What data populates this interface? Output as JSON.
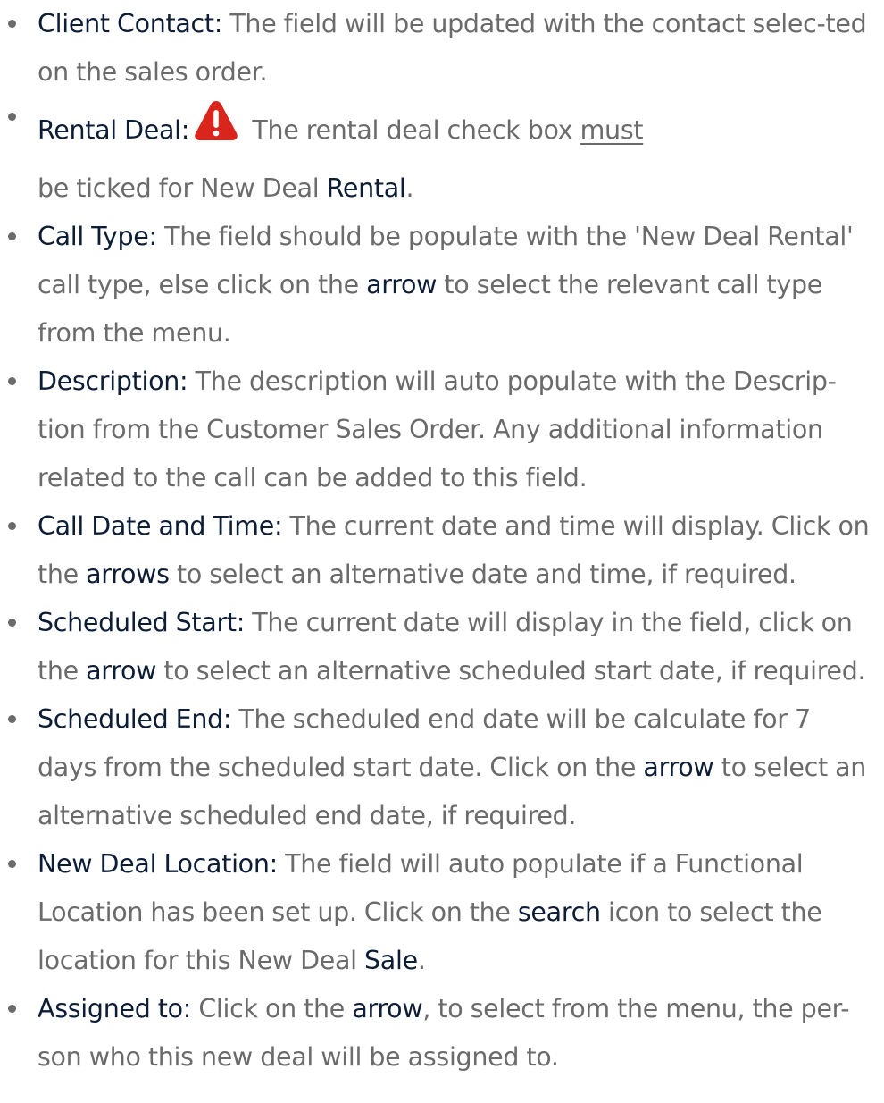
{
  "items": [
    {
      "term": "Client Contact:",
      "text": " The field will be updated with the contact selec-ted on the sales order."
    },
    {
      "term": "Rental Deal:",
      "icon": "warning-triangle-icon",
      "pre": " The rental deal check box ",
      "underlined": "must",
      "mid": " be ticked for New Deal ",
      "kw": "Rental",
      "post": "."
    },
    {
      "term": "Call Type:",
      "pre": " The field should be populate with the 'New Deal Rental' call type, else click on the ",
      "kw": "arrow",
      "post": " to select the relevant call type from the menu."
    },
    {
      "term": "Description:",
      "text": " The description will auto populate with the Descrip-tion from the Customer Sales Order. Any additional information related to the call can be added to this field."
    },
    {
      "term": "Call Date and Time:",
      "pre": " The current date and time will display. Click on the ",
      "kw": "arrows",
      "post": " to select an alternative date and time, if required."
    },
    {
      "term": "Scheduled Start:",
      "pre": " The current date will display in the field, click on the ",
      "kw": "arrow",
      "post": " to select an alternative scheduled start date, if required."
    },
    {
      "term": "Scheduled End:",
      "pre": " The scheduled end date will be calculate for 7 days from the scheduled start date. Click on the ",
      "kw": "arrow",
      "post": " to select an alternative scheduled end date, if required."
    },
    {
      "term": "New Deal Location:",
      "pre": " The field will auto populate if a Functional Location has been set up. Click on the ",
      "kw": "search",
      "mid": " icon to select the location for this New Deal ",
      "kw2": "Sale",
      "post": "."
    },
    {
      "term": "Assigned to:",
      "pre": " Click on the  ",
      "kw": "arrow",
      "post": ", to select from the menu, the per-son who this new deal will be assigned to."
    }
  ],
  "colors": {
    "body_text": "#6b6b6b",
    "term_text": "#0c1d35",
    "warning_red": "#d9251c"
  }
}
